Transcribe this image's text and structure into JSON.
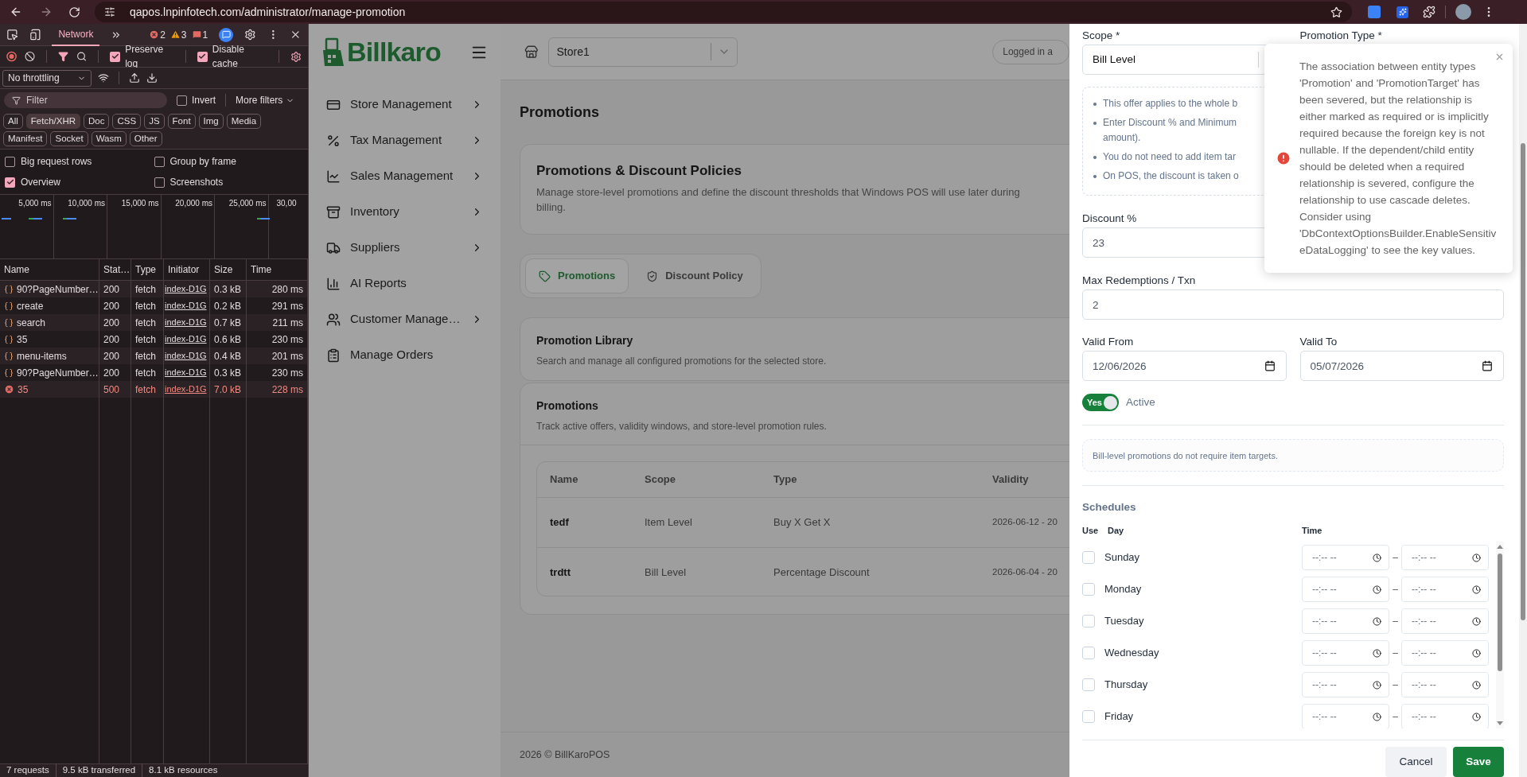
{
  "browser": {
    "url": "qapos.lnpinfotech.com/administrator/manage-promotion"
  },
  "devtools": {
    "tabs": [
      {
        "label": "Network",
        "selected": true
      }
    ],
    "counts": [
      {
        "kind": "error",
        "count": "2"
      },
      {
        "kind": "warning",
        "count": "3"
      },
      {
        "kind": "issue",
        "count": "1"
      }
    ],
    "options": [
      {
        "label": "Preserve log",
        "checked": true
      },
      {
        "label": "Disable cache",
        "checked": true
      }
    ],
    "throttling": "No throttling",
    "filter": {
      "placeholder": "Filter"
    },
    "invert": {
      "label": "Invert",
      "checked": false
    },
    "more_filters": "More filters",
    "type_filters": [
      {
        "label": "All",
        "selected": false
      },
      {
        "label": "Fetch/XHR",
        "selected": true
      },
      {
        "label": "Doc",
        "selected": false
      },
      {
        "label": "CSS",
        "selected": false
      },
      {
        "label": "JS",
        "selected": false
      },
      {
        "label": "Font",
        "selected": false
      },
      {
        "label": "Img",
        "selected": false
      },
      {
        "label": "Media",
        "selected": false
      },
      {
        "label": "Manifest",
        "selected": false
      },
      {
        "label": "Socket",
        "selected": false
      },
      {
        "label": "Wasm",
        "selected": false
      },
      {
        "label": "Other",
        "selected": false
      }
    ],
    "settings": [
      {
        "label": "Big request rows",
        "checked": false
      },
      {
        "label": "Group by frame",
        "checked": false
      },
      {
        "label": "Overview",
        "checked": true
      },
      {
        "label": "Screenshots",
        "checked": false
      }
    ],
    "overview_ticks": [
      "5,000 ms",
      "10,000 ms",
      "15,000 ms",
      "20,000 ms",
      "25,000 ms",
      "30,00"
    ],
    "table": {
      "columns": [
        "Name",
        "Stat…",
        "Type",
        "Initiator",
        "Size",
        "Time"
      ],
      "rows": [
        {
          "name": "90?PageNumber…",
          "status": "200",
          "type": "fetch",
          "initiator": "index-D1G",
          "size": "0.3 kB",
          "time": "280 ms",
          "failed": false
        },
        {
          "name": "create",
          "status": "200",
          "type": "fetch",
          "initiator": "index-D1G",
          "size": "0.2 kB",
          "time": "291 ms",
          "failed": false
        },
        {
          "name": "search",
          "status": "200",
          "type": "fetch",
          "initiator": "index-D1G",
          "size": "0.7 kB",
          "time": "211 ms",
          "failed": false
        },
        {
          "name": "35",
          "status": "200",
          "type": "fetch",
          "initiator": "index-D1G",
          "size": "0.6 kB",
          "time": "230 ms",
          "failed": false
        },
        {
          "name": "menu-items",
          "status": "200",
          "type": "fetch",
          "initiator": "index-D1G",
          "size": "0.4 kB",
          "time": "201 ms",
          "failed": false
        },
        {
          "name": "90?PageNumber…",
          "status": "200",
          "type": "fetch",
          "initiator": "index-D1G",
          "size": "0.3 kB",
          "time": "230 ms",
          "failed": false
        },
        {
          "name": "35",
          "status": "500",
          "type": "fetch",
          "initiator": "index-D1G",
          "size": "7.0 kB",
          "time": "228 ms",
          "failed": true
        }
      ]
    },
    "status_bar": [
      "7 requests",
      "9.5 kB transferred",
      "8.1 kB resources"
    ]
  },
  "app": {
    "logo": "Billkaro",
    "store": "Store1",
    "logged_in": "Logged in a",
    "menu": [
      {
        "label": "Store Management",
        "has_submenu": true
      },
      {
        "label": "Tax Management",
        "has_submenu": true
      },
      {
        "label": "Sales Management",
        "has_submenu": true
      },
      {
        "label": "Inventory",
        "has_submenu": true
      },
      {
        "label": "Suppliers",
        "has_submenu": true
      },
      {
        "label": "AI Reports",
        "has_submenu": false
      },
      {
        "label": "Customer Manage…",
        "has_submenu": true
      },
      {
        "label": "Manage Orders",
        "has_submenu": false
      }
    ],
    "page_title": "Promotions",
    "intro": {
      "title": "Promotions & Discount Policies",
      "description": "Manage store-level promotions and define the discount thresholds that Windows POS will use later during billing."
    },
    "tabs": [
      {
        "label": "Promotions",
        "selected": true
      },
      {
        "label": "Discount Policy",
        "selected": false
      }
    ],
    "library": {
      "title": "Promotion Library",
      "description": "Search and manage all configured promotions for the selected store."
    },
    "promotions": {
      "title": "Promotions",
      "description": "Track active offers, validity windows, and store-level promotion rules.",
      "table": {
        "columns": [
          "Name",
          "Scope",
          "Type",
          "Validity"
        ],
        "rows": [
          [
            "tedf",
            "Item Level",
            "Buy X Get X",
            "2026-06-12 - 20"
          ],
          [
            "trdtt",
            "Bill Level",
            "Percentage Discount",
            "2026-06-04 - 20"
          ]
        ]
      }
    },
    "footer": "2026 © BillKaroPOS"
  },
  "drawer": {
    "scope": {
      "label": "Scope *",
      "value": "Bill Level"
    },
    "promotion_type": {
      "label": "Promotion Type *"
    },
    "info_bullets": [
      {
        "lines": [
          "This offer applies to the whole b"
        ]
      },
      {
        "lines": [
          "Enter Discount % and Minimum",
          "amount)."
        ]
      },
      {
        "lines": [
          "You do not need to add item tar"
        ]
      },
      {
        "lines": [
          "On POS, the discount is taken o"
        ]
      }
    ],
    "discount": {
      "label": "Discount %",
      "value": "23"
    },
    "max_redemptions": {
      "label": "Max Redemptions / Txn",
      "value": "2"
    },
    "valid_from": {
      "label": "Valid From",
      "value": "12/06/2026"
    },
    "valid_to": {
      "label": "Valid To",
      "value": "05/07/2026"
    },
    "active": {
      "toggle_label": "Yes",
      "label": "Active",
      "on": true
    },
    "note": "Bill-level promotions do not require item targets.",
    "schedules": {
      "title": "Schedules",
      "columns": [
        "Use",
        "Day",
        "Time"
      ],
      "rows": [
        {
          "day": "Sunday",
          "checked": false,
          "start_placeholder": "--:-- --",
          "separator": "–",
          "end_placeholder": "--:-- --"
        },
        {
          "day": "Monday",
          "checked": false,
          "start_placeholder": "--:-- --",
          "separator": "–",
          "end_placeholder": "--:-- --"
        },
        {
          "day": "Tuesday",
          "checked": false,
          "start_placeholder": "--:-- --",
          "separator": "–",
          "end_placeholder": "--:-- --"
        },
        {
          "day": "Wednesday",
          "checked": false,
          "start_placeholder": "--:-- --",
          "separator": "–",
          "end_placeholder": "--:-- --"
        },
        {
          "day": "Thursday",
          "checked": false,
          "start_placeholder": "--:-- --",
          "separator": "–",
          "end_placeholder": "--:-- --"
        },
        {
          "day": "Friday",
          "checked": false,
          "start_placeholder": "--:-- --",
          "separator": "–",
          "end_placeholder": "--:-- --"
        }
      ]
    },
    "buttons": [
      {
        "label": "Cancel",
        "kind": "secondary"
      },
      {
        "label": "Save",
        "kind": "primary"
      }
    ]
  },
  "toast": {
    "kind": "error",
    "message": "The association between entity types 'Promotion' and 'PromotionTarget' has been severed, but the relationship is either marked as required or is implicitly required because the foreign key is not nullable. If the dependent/child entity should be deleted when a required relationship is severed, configure the relationship to use cascade deletes. Consider using 'DbContextOptionsBuilder.EnableSensitiveDataLogging' to see the key values."
  }
}
